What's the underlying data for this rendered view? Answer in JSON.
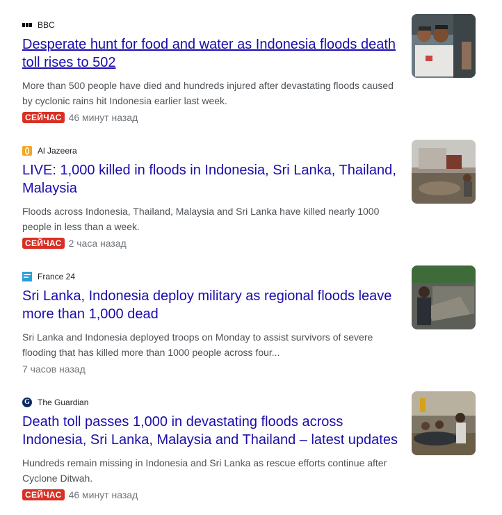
{
  "articles": [
    {
      "source": "BBC",
      "source_icon": "bbc-icon",
      "headline": "Desperate hunt for food and water as Indonesia floods death toll rises to 502",
      "snippet": "More than 500 people have died and hundreds injured after devastating floods caused by cyclonic rains hit Indonesia earlier last week.",
      "badge": "СЕЙЧАС",
      "time": "46 минут назад",
      "thumbnail": "flood-children-photo"
    },
    {
      "source": "Al Jazeera",
      "source_icon": "al-jazeera-icon",
      "headline": "LIVE: 1,000 killed in floods in Indonesia, Sri Lanka, Thailand, Malaysia",
      "snippet": "Floods across Indonesia, Thailand, Malaysia and Sri Lanka have killed nearly 1000 people in less than a week.",
      "badge": "СЕЙЧАС",
      "time": "2 часа назад",
      "thumbnail": "flood-mud-house-photo"
    },
    {
      "source": "France 24",
      "source_icon": "france24-icon",
      "headline": "Sri Lanka, Indonesia deploy military as regional floods leave more than 1,000 dead",
      "snippet": "Sri Lanka and Indonesia deployed troops on Monday to assist survivors of severe flooding that has killed more than 1000 people across four...",
      "badge": "",
      "time": "7 часов назад",
      "thumbnail": "flood-debris-photo"
    },
    {
      "source": "The Guardian",
      "source_icon": "guardian-icon",
      "headline": "Death toll passes 1,000 in devastating floods across Indonesia, Sri Lanka, Malaysia and Thailand – latest updates",
      "snippet": "Hundreds remain missing in Indonesia and Sri Lanka as rescue efforts continue after Cyclone Ditwah.",
      "badge": "СЕЙЧАС",
      "time": "46 минут назад",
      "thumbnail": "flood-rescue-boat-photo"
    }
  ],
  "colors": {
    "headline": "#1a0dab",
    "badge_bg": "#d93025",
    "snippet": "#4d5156",
    "meta": "#70757a"
  }
}
